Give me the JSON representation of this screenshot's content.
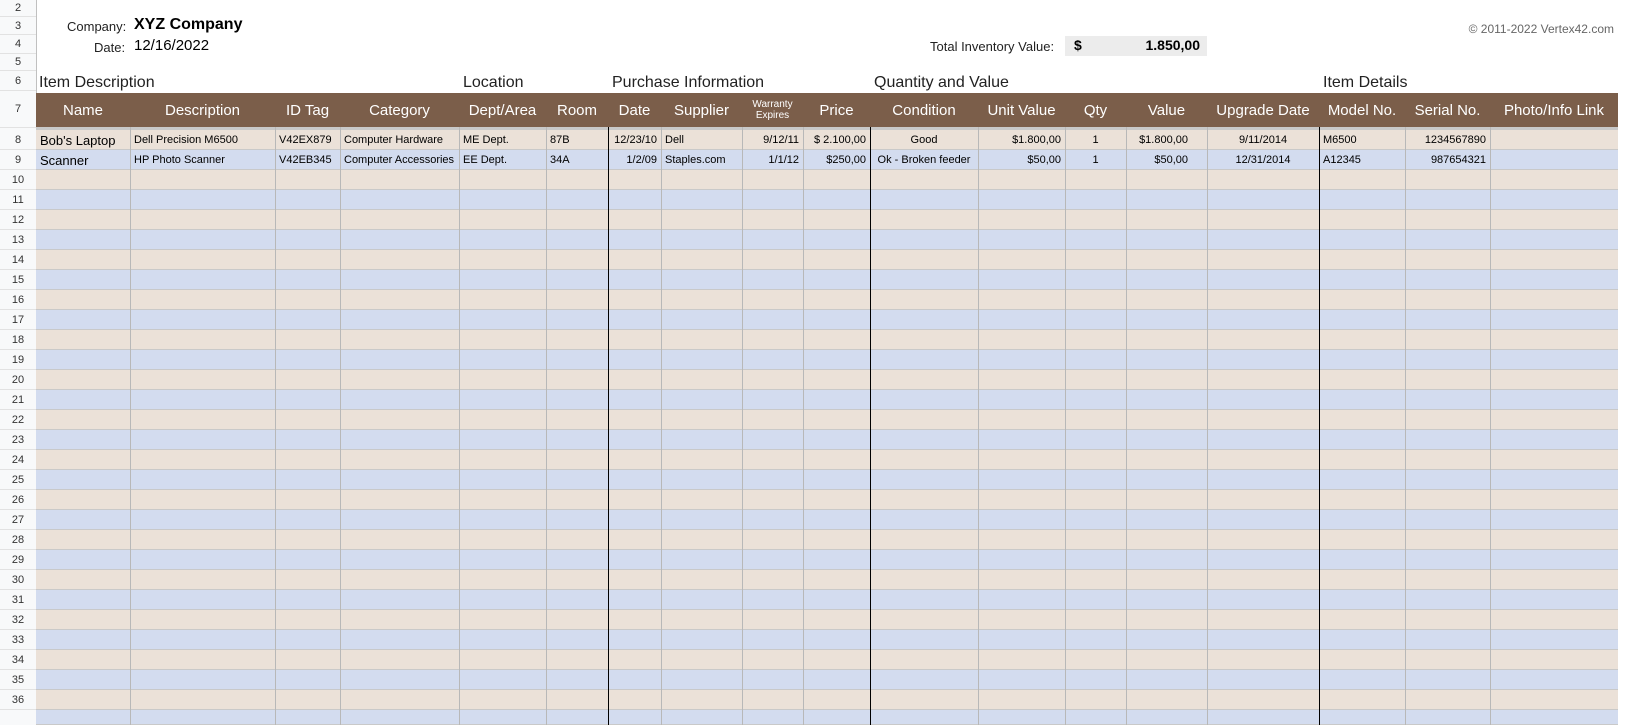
{
  "row_numbers": [
    "2",
    "3",
    "4",
    "5",
    "6",
    "7",
    "8",
    "9",
    "10",
    "11",
    "12",
    "13",
    "14",
    "15",
    "16",
    "17",
    "18",
    "19",
    "20",
    "21",
    "22",
    "23",
    "24",
    "25",
    "26",
    "27",
    "28",
    "29",
    "30",
    "31",
    "32",
    "33",
    "34",
    "35",
    "36"
  ],
  "header": {
    "company_label": "Company:",
    "company_name": "XYZ Company",
    "date_label": "Date:",
    "date_value": "12/16/2022",
    "total_label": "Total Inventory Value:",
    "currency_symbol": "$",
    "total_value": "1.850,00",
    "copyright": "© 2011-2022 Vertex42.com"
  },
  "sections": {
    "item_description": "Item Description",
    "location": "Location",
    "purchase_information": "Purchase Information",
    "quantity_and_value": "Quantity and Value",
    "item_details": "Item Details"
  },
  "columns": [
    "Name",
    "Description",
    "ID Tag",
    "Category",
    "Dept/Area",
    "Room",
    "Date",
    "Supplier",
    "Warranty Expires",
    "Price",
    "Condition",
    "Unit Value",
    "Qty",
    "Value",
    "Upgrade Date",
    "Model No.",
    "Serial No.",
    "Photo/Info Link"
  ],
  "rows": [
    [
      "Bob's Laptop",
      "Dell Precision M6500",
      "V42EX879",
      "Computer Hardware",
      "ME Dept.",
      "87B",
      "12/23/10",
      "Dell",
      "9/12/11",
      "$ 2.100,00",
      "Good",
      "$1.800,00",
      "1",
      "$1.800,00",
      "9/11/2014",
      "M6500",
      "1234567890",
      ""
    ],
    [
      "Scanner",
      "HP Photo Scanner",
      "V42EB345",
      "Computer Accessories",
      "EE Dept.",
      "34A",
      "1/2/09",
      "Staples.com",
      "1/1/12",
      "$250,00",
      "Ok - Broken feeder",
      "$50,00",
      "1",
      "$50,00",
      "12/31/2014",
      "A12345",
      "987654321",
      ""
    ]
  ],
  "colors": {
    "header_brown": "#7b5e4a",
    "row_tan": "#ebe1d8",
    "row_blue": "#d3dcef"
  }
}
